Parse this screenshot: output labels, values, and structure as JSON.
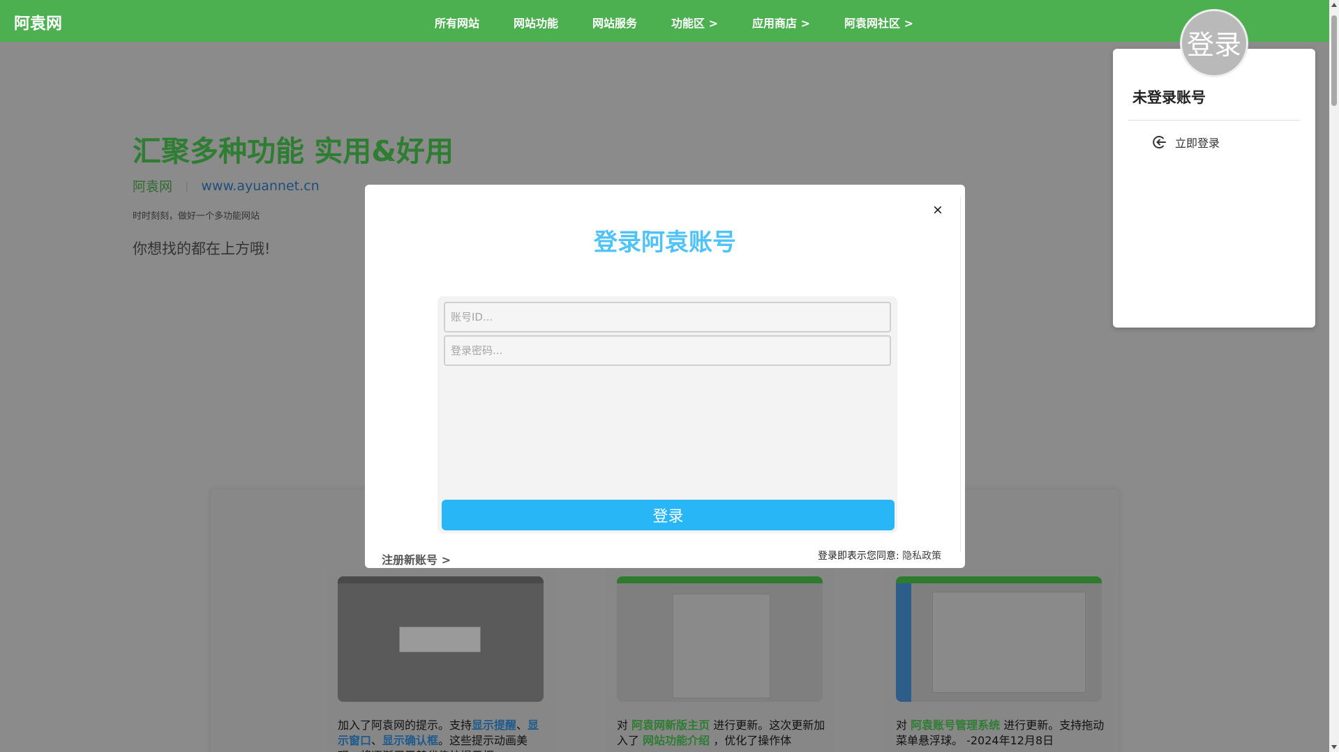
{
  "header": {
    "brand": "阿袁网",
    "nav": [
      {
        "label": "所有网站"
      },
      {
        "label": "网站功能"
      },
      {
        "label": "网站服务"
      },
      {
        "label": "功能区 >"
      },
      {
        "label": "应用商店 >"
      },
      {
        "label": "阿袁网社区 >"
      }
    ],
    "avatar_text": "登录"
  },
  "hero": {
    "title": "汇聚多种功能 实用&好用",
    "site_name": "阿袁网",
    "separator": "|",
    "url": "www.ayuannet.cn",
    "tagline": "时时刻刻，做好一个多功能网站",
    "find_text": "你想找的都在上方哦!"
  },
  "account_panel": {
    "title": "未登录账号",
    "login_label": "立即登录"
  },
  "modal": {
    "close_symbol": "×",
    "title": "登录阿袁账号",
    "account_placeholder": "账号ID...",
    "password_placeholder": "登录密码...",
    "submit_label": "登录",
    "register_label": "注册新账号 >",
    "agree_text": "登录即表示您同意:",
    "privacy_label": "隐私政策"
  },
  "cards": [
    {
      "pre": "加入了阿袁网的提示。支持",
      "hl1": "显示提醒",
      "mid1": "、",
      "hl2": "显示窗口",
      "mid2": "、",
      "hl3": "显示确认框",
      "post": "。这些提示动画美观，将逐渐用于替代传统提示框。"
    },
    {
      "pre": "对 ",
      "hl1": "阿袁网新版主页",
      "mid1": " 进行更新。这次更新加入了 ",
      "hl2": "网站功能介绍",
      "post": " ，优化了操作体"
    },
    {
      "pre": "对 ",
      "hl1": "阿袁账号管理系统",
      "mid1": " 进行更新。支持拖动菜单悬浮球。 -2024年12月8日"
    }
  ],
  "colors": {
    "nav_green": "#4caf50",
    "accent_blue": "#29b6f6",
    "title_blue": "#4fc3f7"
  }
}
